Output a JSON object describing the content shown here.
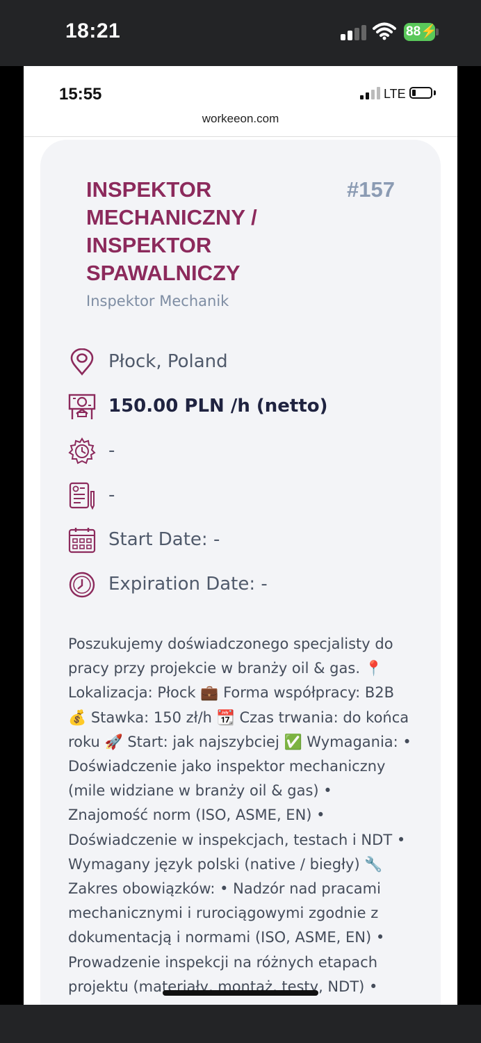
{
  "device": {
    "time": "18:21",
    "battery": "88"
  },
  "screenshot": {
    "time": "15:55",
    "network": "LTE",
    "url": "workeeon.com"
  },
  "job": {
    "title": "INSPEKTOR MECHANICZNY / INSPEKTOR SPAWALNICZY",
    "id": "#157",
    "subtitle": "Inspektor Mechanik",
    "details": {
      "location": "Płock, Poland",
      "rate": "150.00 PLN /h (netto)",
      "work_time": "-",
      "contract": "-",
      "start_date": "Start Date: -",
      "expiration_date": "Expiration Date: -"
    },
    "description": "Poszukujemy doświadczonego specjalisty do pracy przy projekcie w branży oil & gas. 📍 Lokalizacja: Płock 💼 Forma współpracy: B2B 💰 Stawka: 150 zł/h 📆 Czas trwania: do końca roku 🚀 Start: jak najszybciej ✅ Wymagania: • Doświadczenie jako inspektor mechaniczny (mile widziane w branży oil & gas) • Znajomość norm (ISO, ASME, EN) • Doświadczenie w inspekcjach, testach i NDT • Wymagany język polski (native / biegły) 🔧 Zakres obowiązków: • Nadzór nad pracami mechanicznymi i rurociągowymi zgodnie z dokumentacją i normami (ISO, ASME, EN) • Prowadzenie inspekcji na różnych etapach projektu (materiały, montaż, testy, NDT) •"
  },
  "colors": {
    "brand": "#8c2a5c",
    "id_gray": "#8b9bb3",
    "card_bg": "#f3f4f7",
    "battery_green": "#5ac85a"
  },
  "icons": [
    "signal-icon",
    "wifi-icon",
    "battery-icon",
    "location-pin-icon",
    "money-icon",
    "gear-clock-icon",
    "contract-document-icon",
    "calendar-icon",
    "clock-icon"
  ]
}
